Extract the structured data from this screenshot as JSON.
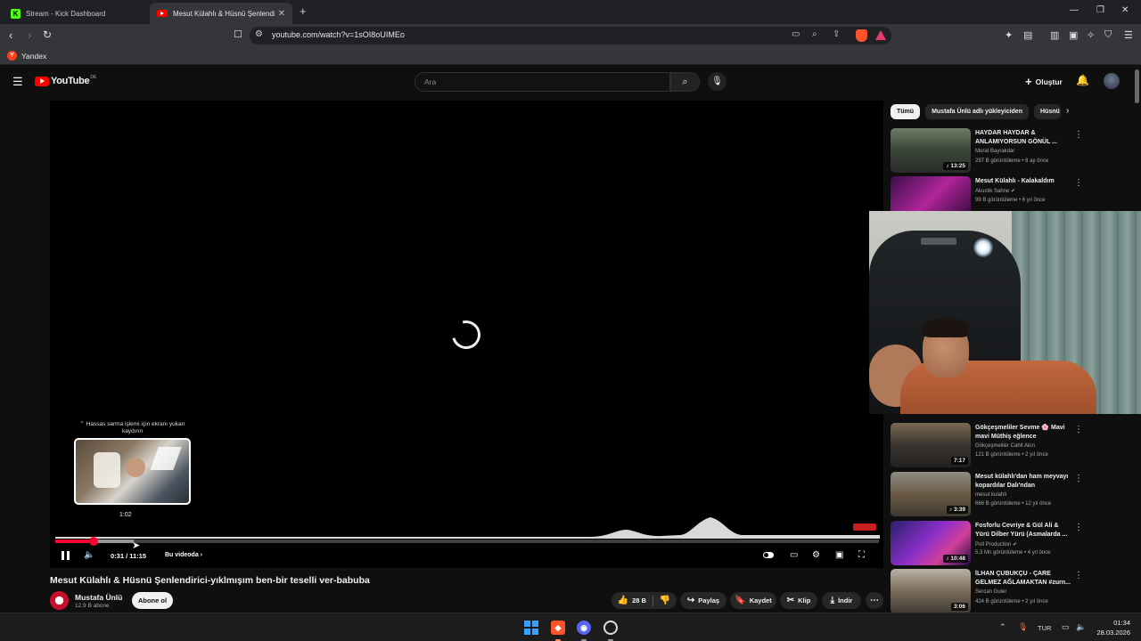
{
  "browser": {
    "tabs": [
      {
        "label": "Stream - Kick Dashboard",
        "icon": "kick-icon",
        "active": false
      },
      {
        "label": "Mesut Külahlı & Hüsnü Şenlendi",
        "icon": "youtube-icon",
        "active": true
      }
    ],
    "url": "youtube.com/watch?v=1sOI8oUIMEo",
    "bookmarks": [
      {
        "label": "Yandex",
        "icon": "yandex-icon"
      }
    ]
  },
  "youtube": {
    "logo_text": "YouTube",
    "logo_region": "DE",
    "search_placeholder": "Ara",
    "create_label": "Oluştur"
  },
  "player": {
    "seek_hint": "Hassas sarma işlemi için ekranı yukarı kaydırın",
    "preview_time": "1:02",
    "current_time": "0:31",
    "duration": "11:15",
    "time_display": "0:31 / 11:15",
    "chapters_label": "Bu videoda",
    "progress_fraction": 0.046,
    "buffered_fraction": 0.095,
    "accent_color": "#ff0033"
  },
  "video": {
    "title": "Mesut Külahlı & Hüsnü Şenlendirici-yıklmışım ben-bir teselli ver-babuba",
    "channel": "Mustafa Ünlü",
    "subscribers": "12,9 B abone",
    "subscribe_label": "Abone ol",
    "likes": "28 B",
    "share_label": "Paylaş",
    "save_label": "Kaydet",
    "clip_label": "Klip",
    "download_label": "İndir"
  },
  "sidebar": {
    "chips": [
      "Tümü",
      "Mustafa Ünlü adlı yükleyiciden",
      "Hüsnü"
    ],
    "recommendations": [
      {
        "title": "HAYDAR HAYDAR & ANLAMIYORSUN GÖNÜL ...",
        "channel": "Murat Bayrakdar",
        "meta": "297 B görüntüleme • 8 ay önce",
        "duration": "13:25",
        "verified": false
      },
      {
        "title": "Mesut Külahlı - Kalakaldım",
        "channel": "Akustik Sahne",
        "meta": "99 B görüntüleme • 6 yıl önce",
        "duration": "",
        "verified": true
      },
      {
        "title": "Gökçeşmeliler Sevme 🌸 Mavi mavi Müthiş eğlence",
        "channel": "Gökçeşmeliler Cahit Akın",
        "meta": "121 B görüntüleme • 2 yıl önce",
        "duration": "7:17",
        "verified": false
      },
      {
        "title": "Mesut külahlı'dan ham meyvayı kopardılar Dalı'ndan",
        "channel": "mesut kulahli",
        "meta": "666 B görüntüleme • 12 yıl önce",
        "duration": "3:39",
        "verified": false
      },
      {
        "title": "Fosforlu Cevriye & Gül Ali & Yürü Dilber Yürü (Asmalarda ...",
        "channel": "Poll Production",
        "meta": "5,3 Mn görüntüleme • 4 yıl önce",
        "duration": "10:48",
        "verified": true
      },
      {
        "title": "İLHAN ÇUBUKÇU - ÇARE GELMEZ AĞLAMAKTAN #zurn...",
        "channel": "Sercan Guler",
        "meta": "424 B görüntüleme • 2 yıl önce",
        "duration": "3:06",
        "verified": false
      }
    ]
  },
  "taskbar": {
    "language": "TUR",
    "time": "01:34",
    "date": "28.03.2026"
  }
}
